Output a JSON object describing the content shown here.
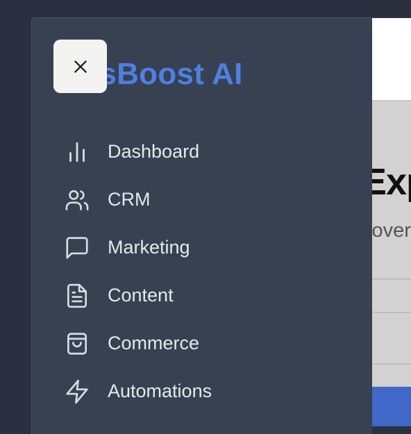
{
  "app": {
    "brand": "lesBoost AI",
    "close_icon": "close-icon"
  },
  "nav": {
    "items": [
      {
        "label": "Dashboard",
        "icon": "bar-chart-icon"
      },
      {
        "label": "CRM",
        "icon": "users-icon"
      },
      {
        "label": "Marketing",
        "icon": "message-square-icon"
      },
      {
        "label": "Content",
        "icon": "file-text-icon"
      },
      {
        "label": "Commerce",
        "icon": "shopping-bag-icon"
      },
      {
        "label": "Automations",
        "icon": "lightning-icon"
      }
    ]
  },
  "background_page": {
    "heading_fragment": "Exp",
    "subtitle_fragment": "cover"
  },
  "colors": {
    "drawer_bg": "#374152",
    "brand": "#4f7fe0",
    "nav_text": "#e6e8ec",
    "backdrop": "#2a3040",
    "accent_button": "#4168c8"
  }
}
